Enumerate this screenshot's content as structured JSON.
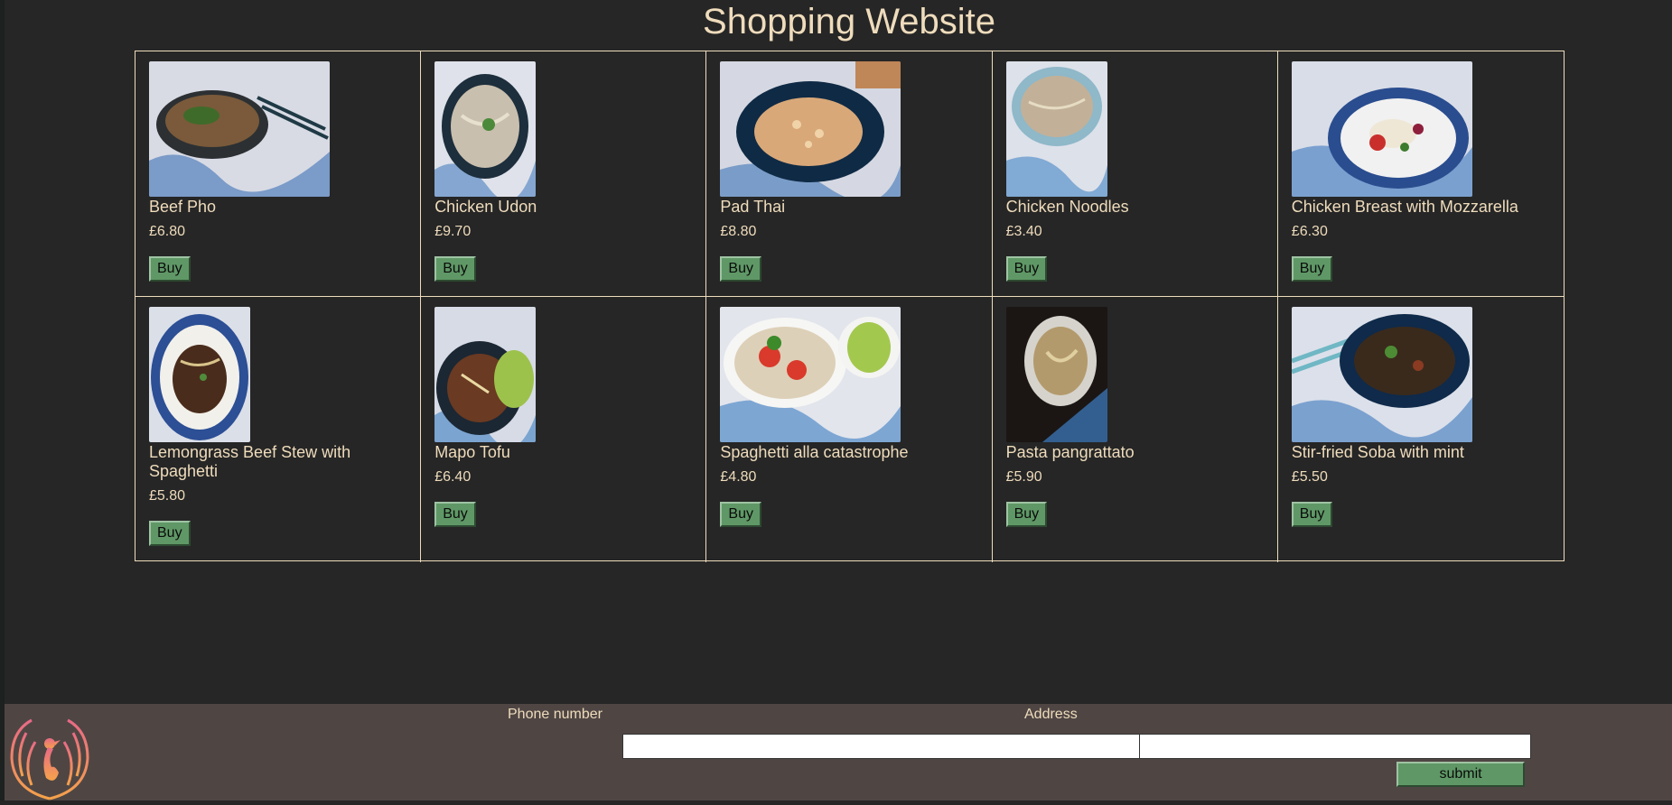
{
  "page": {
    "title": "Shopping Website"
  },
  "products": [
    {
      "name": "Beef Pho",
      "price": "£6.80",
      "buy_label": "Buy"
    },
    {
      "name": "Chicken Udon",
      "price": "£9.70",
      "buy_label": "Buy"
    },
    {
      "name": "Pad Thai",
      "price": "£8.80",
      "buy_label": "Buy"
    },
    {
      "name": "Chicken Noodles",
      "price": "£3.40",
      "buy_label": "Buy"
    },
    {
      "name": "Chicken Breast with Mozzarella",
      "price": "£6.30",
      "buy_label": "Buy"
    },
    {
      "name": "Lemongrass Beef Stew with Spaghetti",
      "price": "£5.80",
      "buy_label": "Buy"
    },
    {
      "name": "Mapo Tofu",
      "price": "£6.40",
      "buy_label": "Buy"
    },
    {
      "name": "Spaghetti alla catastrophe",
      "price": "£4.80",
      "buy_label": "Buy"
    },
    {
      "name": "Pasta pangrattato",
      "price": "£5.90",
      "buy_label": "Buy"
    },
    {
      "name": "Stir-fried Soba with mint",
      "price": "£5.50",
      "buy_label": "Buy"
    }
  ],
  "footer": {
    "phone_label": "Phone number",
    "phone_value": "",
    "address_label": "Address",
    "address_value": "",
    "submit_label": "submit"
  },
  "colors": {
    "background": "#262626",
    "text": "#efdcbc",
    "button": "#5f9866",
    "footer": "#4f4644"
  }
}
